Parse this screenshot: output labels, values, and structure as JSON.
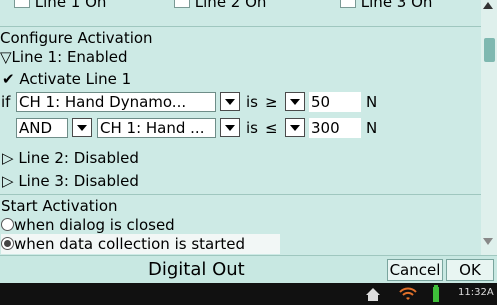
{
  "top_row": [
    "Line 1 On",
    "Line 2 On",
    "Line 3 On"
  ],
  "configure": {
    "heading": "Configure Activation",
    "line1": {
      "label": "Line 1: Enabled",
      "activate_label": "Activate Line 1"
    },
    "cond1": {
      "prefix": "if",
      "sensor": "CH 1: Hand Dynamo...",
      "is": "is",
      "op": "≥",
      "value": "50",
      "unit": "N"
    },
    "cond2": {
      "logic": "AND",
      "sensor": "CH 1: Hand ...",
      "is": "is",
      "op": "≤",
      "value": "300",
      "unit": "N"
    },
    "line2": "Line 2: Disabled",
    "line3": "Line 3: Disabled"
  },
  "start": {
    "heading": "Start Activation",
    "opt_dialog": "when dialog is closed",
    "opt_collect": "when data collection is started",
    "selected": "opt_collect"
  },
  "footer": {
    "title": "Digital Out",
    "cancel": "Cancel",
    "ok": "OK"
  },
  "statusbar": {
    "time": "11:32A"
  }
}
